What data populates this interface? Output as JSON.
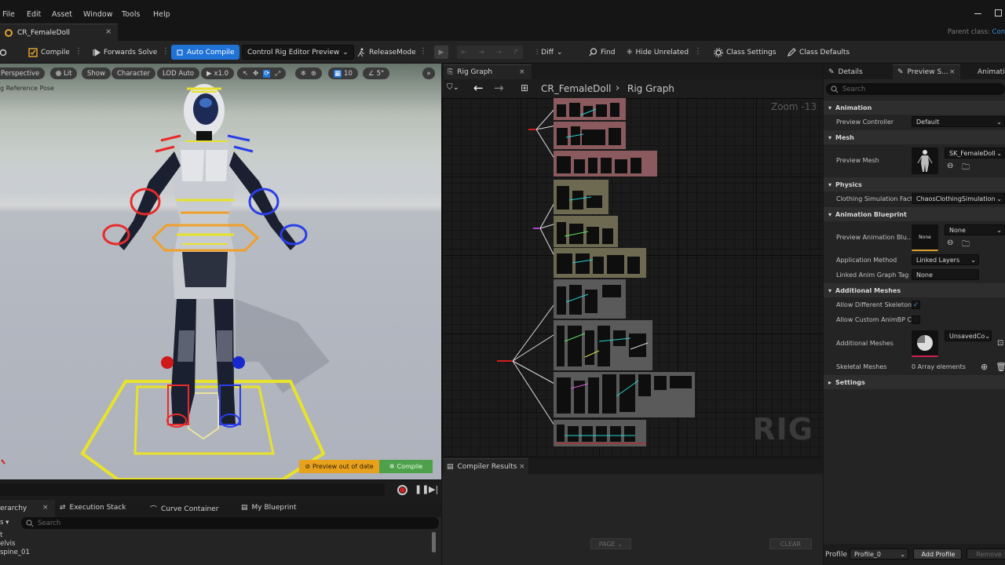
{
  "menu": {
    "items": [
      "File",
      "Edit",
      "Asset",
      "Window",
      "Tools",
      "Help"
    ]
  },
  "doc_tab": {
    "label": "CR_FemaleDoll"
  },
  "parent_class": {
    "label": "Parent class:",
    "value": "Con"
  },
  "toolbar": {
    "compile": "Compile",
    "forwards_solve": "Forwards Solve",
    "auto_compile": "Auto Compile",
    "preview_mode": "Control Rig Editor Preview",
    "release_mode": "ReleaseMode",
    "diff": "Diff",
    "find": "Find",
    "hide_unrelated": "Hide Unrelated",
    "class_settings": "Class Settings",
    "class_defaults": "Class Defaults"
  },
  "viewport": {
    "chips": [
      "Perspective",
      "Lit",
      "Show",
      "Character",
      "LOD Auto"
    ],
    "speed": "x1.0",
    "grid_snap": "10",
    "angle_snap": "5°",
    "caption": "g Reference Pose",
    "preview_warning": "Preview out of date",
    "preview_compile": "Compile"
  },
  "bottom_left": {
    "tabs": [
      "erarchy",
      "Execution Stack",
      "Curve Container",
      "My Blueprint"
    ],
    "search_placeholder": "Search",
    "filter": "s",
    "tree": [
      "t",
      "elvis",
      "spine_01"
    ]
  },
  "graph": {
    "tab": "Rig Graph",
    "breadcrumb_asset": "CR_FemaleDoll",
    "breadcrumb_graph": "Rig Graph",
    "zoom": "Zoom -13",
    "watermark": "RIG"
  },
  "compiler": {
    "tab": "Compiler Results",
    "page_button": "PAGE",
    "clear_button": "CLEAR"
  },
  "details": {
    "tabs": [
      "Details",
      "Preview S...",
      "Animatio"
    ],
    "search_placeholder": "Search",
    "sections": {
      "animation": "Animation",
      "mesh": "Mesh",
      "physics": "Physics",
      "animation_blueprint": "Animation Blueprint",
      "additional_meshes": "Additional Meshes",
      "settings": "Settings"
    },
    "props": {
      "preview_controller_label": "Preview Controller",
      "preview_controller_value": "Default",
      "preview_mesh_label": "Preview Mesh",
      "preview_mesh_value": "SK_FemaleDoll",
      "clothing_label": "Clothing Simulation Fact",
      "clothing_value": "ChaosClothingSimulation",
      "preview_anim_label": "Preview Animation Blu...",
      "preview_anim_thumb": "None",
      "preview_anim_value": "None",
      "app_method_label": "Application Method",
      "app_method_value": "Linked Layers",
      "linked_tag_label": "Linked Anim Graph Tag",
      "linked_tag_value": "None",
      "allow_diff_label": "Allow Different Skeleton",
      "allow_custom_label": "Allow Custom AnimBP C",
      "additional_meshes_label": "Additional Meshes",
      "additional_meshes_value": "UnsavedCo",
      "skeletal_meshes_label": "Skeletal Meshes",
      "skeletal_meshes_value": "0 Array elements"
    },
    "allow_different_skeleton": true,
    "allow_custom_animbp": false,
    "footer": {
      "profile_label": "Profile",
      "profile_value": "Profile_0",
      "add_profile": "Add Profile",
      "remove_profile": "Remove"
    }
  },
  "colors": {
    "accent_blue": "#1f72d6",
    "warning_orange": "#e7a11d",
    "compile_green": "#4ea04a",
    "link_blue": "#3b8ad6"
  }
}
